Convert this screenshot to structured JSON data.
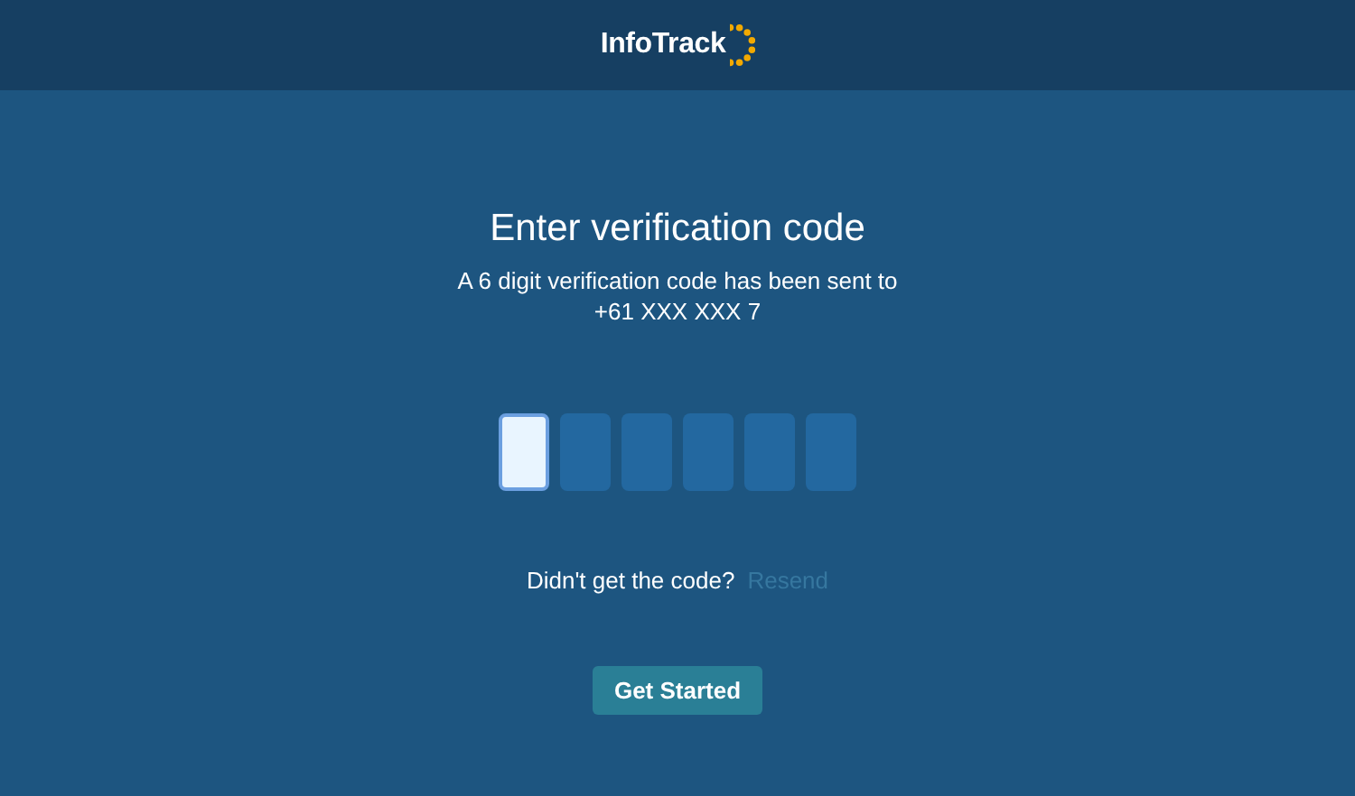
{
  "header": {
    "logo_text": "InfoTrack"
  },
  "title": "Enter verification code",
  "message": "A 6 digit verification code has been sent to",
  "phone": "+61 XXX XXX 7",
  "code_boxes": [
    {
      "selected": true
    },
    {
      "selected": false
    },
    {
      "selected": false
    },
    {
      "selected": false
    },
    {
      "selected": false
    },
    {
      "selected": false
    }
  ],
  "resend": {
    "prompt": "Didn't get the code?",
    "link": "Resend",
    "disabled": true
  },
  "button": "Get Started"
}
